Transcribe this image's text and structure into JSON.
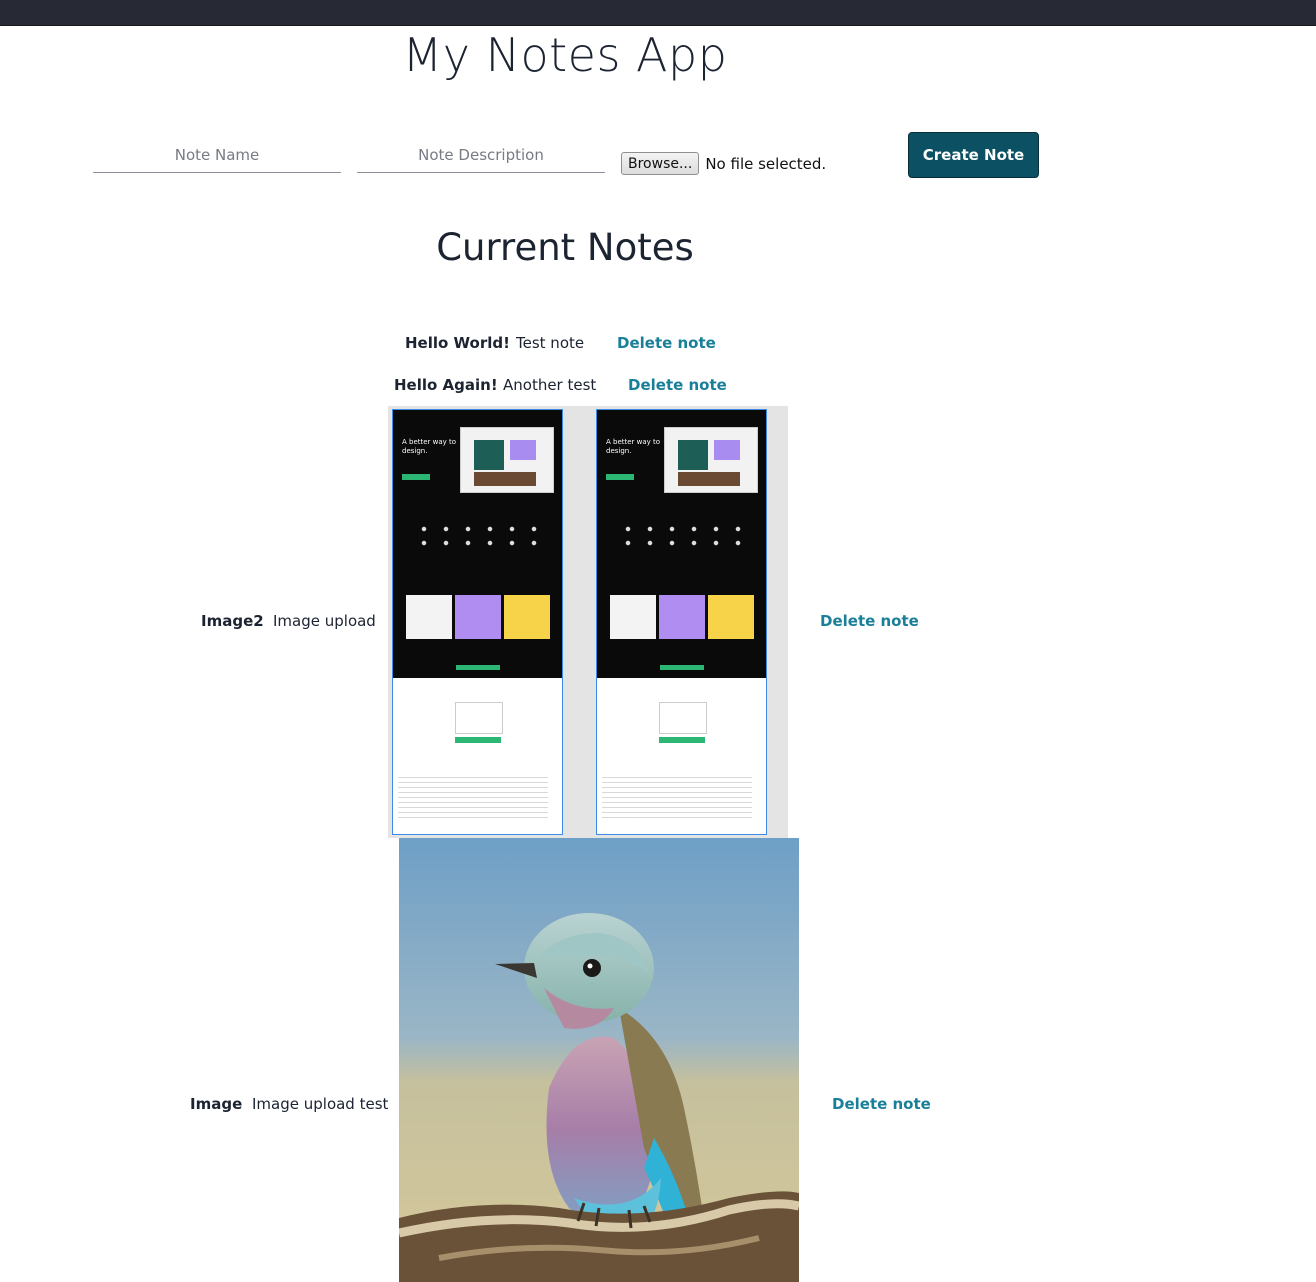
{
  "app": {
    "title": "My Notes App"
  },
  "form": {
    "name_placeholder": "Note Name",
    "description_placeholder": "Note Description",
    "browse_label": "Browse...",
    "file_status": "No file selected.",
    "create_label": "Create Note"
  },
  "section_title": "Current Notes",
  "notes": [
    {
      "name": "Hello World!",
      "description": "Test note",
      "delete_label": "Delete note"
    },
    {
      "name": "Hello Again!",
      "description": "Another test",
      "delete_label": "Delete note"
    },
    {
      "name": "Image2",
      "description": "Image upload",
      "delete_label": "Delete note",
      "image": {
        "content": "figma-landing-page-mockups",
        "mockup_headline": "A better way to design."
      }
    },
    {
      "name": "Image",
      "description": "Image upload test",
      "delete_label": "Delete note",
      "image": {
        "content": "lilac-breasted-roller-bird"
      }
    }
  ],
  "colors": {
    "accent": "#0c5163",
    "link": "#1a7f98",
    "topbar": "#272a35"
  }
}
